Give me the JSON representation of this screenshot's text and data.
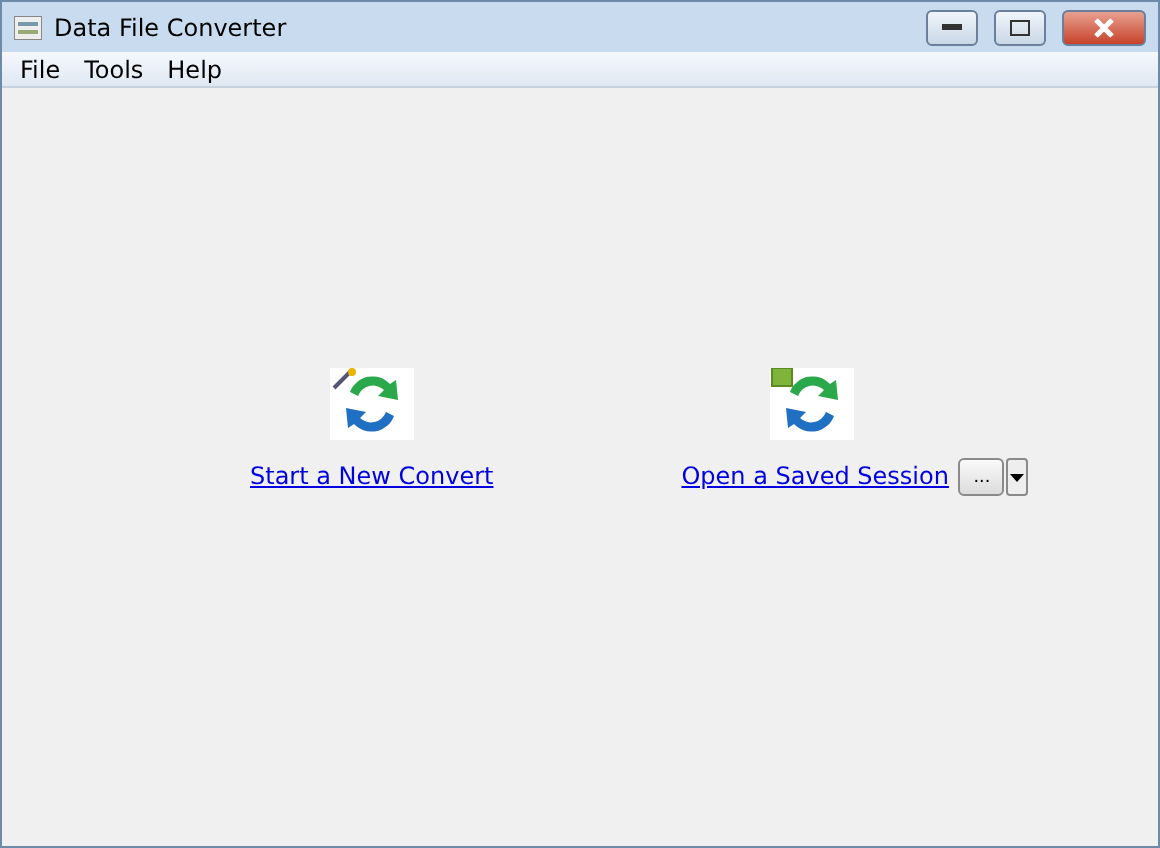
{
  "window": {
    "title": "Data File Converter"
  },
  "menu": [
    "File",
    "Tools",
    "Help"
  ],
  "actions": [
    {
      "kind": "new",
      "label": "Start a New Convert"
    },
    {
      "kind": "open",
      "label": "Open a Saved Session",
      "browse": "..."
    }
  ]
}
